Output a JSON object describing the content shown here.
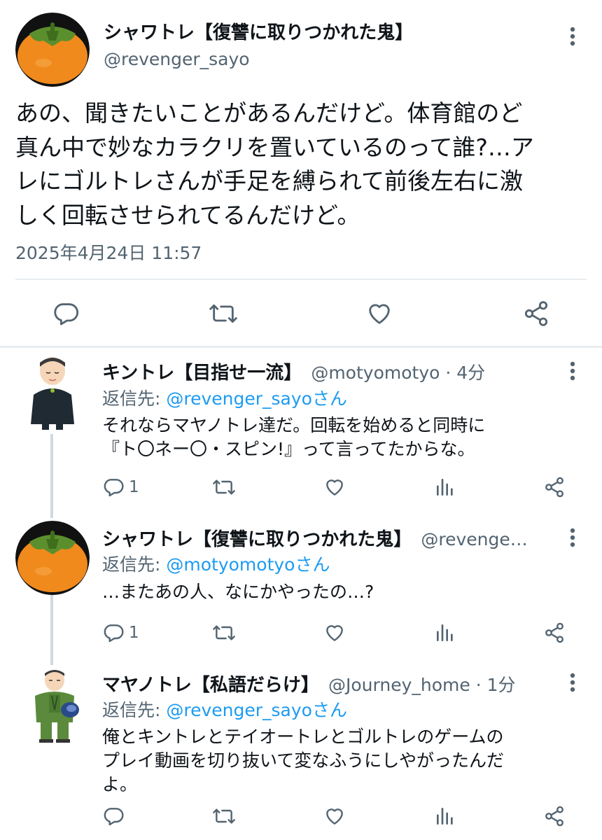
{
  "main_tweet": {
    "author_name": "シャワトレ【復讐に取りつかれた鬼】",
    "handle": "@revenger_sayo",
    "text_lines": [
      "あの、聞きたいことがあるんだけど。体育館のど",
      "真ん中で妙なカラクリを置いているのって誰?…ア",
      "レにゴルトレさんが手足を縛られて前後左右に激",
      "しく回転させられてるんだけど。"
    ],
    "timestamp": "2025年4月24日 11:57"
  },
  "replies": [
    {
      "author_name": "キントレ【目指せ一流】",
      "handle_meta": "@motyomotyo · 4分",
      "reply_label": "返信先: ",
      "reply_mention": "@revenger_sayoさん",
      "text_lines": [
        "それならマヤノトレ達だ。回転を始めると同時に",
        "『ト〇ネー〇・スピン!』って言ってたからな。"
      ],
      "reply_count": "1"
    },
    {
      "author_name": "シャワトレ【復讐に取りつかれた鬼】",
      "handle_meta": "@revenge…",
      "reply_label": "返信先: ",
      "reply_mention": "@motyomotyoさん",
      "text_lines": [
        "…またあの人、なにかやったの…?"
      ],
      "reply_count": "1"
    },
    {
      "author_name": "マヤノトレ【私語だらけ】",
      "handle_meta": "@Journey_home · 1分",
      "reply_label": "返信先: ",
      "reply_mention": "@revenger_sayoさん",
      "text_lines": [
        "俺とキントレとテイオートレとゴルトレのゲームの",
        "プレイ動画を切り抜いて変なふうにしやがったんだ",
        "よ。"
      ],
      "reply_count": ""
    }
  ],
  "icons": [
    "more-vertical-icon",
    "reply-icon",
    "retweet-icon",
    "like-icon",
    "share-icon",
    "views-icon"
  ],
  "colors": {
    "text": "#0f1419",
    "secondary": "#536471",
    "link": "#1d9bf0",
    "divider": "#e6ecf0"
  }
}
